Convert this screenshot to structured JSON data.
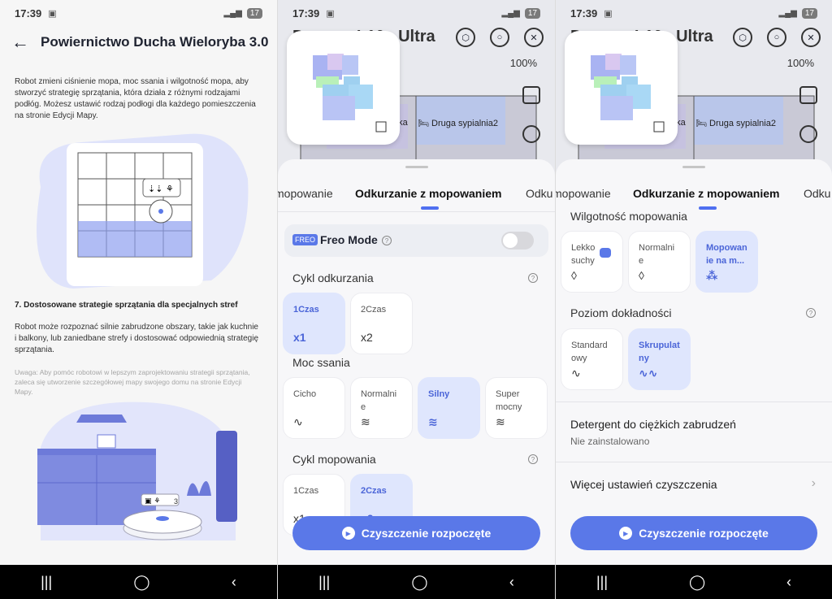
{
  "status": {
    "time": "17:39",
    "battery": "17"
  },
  "p1": {
    "title": "Powiernictwo Ducha Wieloryba 3.0",
    "para1": "Robot zmieni ciśnienie mopa, moc ssania i wilgotność mopa, aby stworzyć strategię sprzątania, która działa z różnymi rodzajami podłóg. Możesz ustawić rodzaj podłogi dla każdego pomieszczenia na stronie Edycji Mapy.",
    "heading7": "7. Dostosowane strategie sprzątania dla specjalnych stref",
    "para2": "Robot może rozpoznać silnie zabrudzone obszary, takie jak kuchnie i balkony, lub zaniedbane strefy i dostosować odpowiednią strategię sprzątania.",
    "note": "Uwaga: Aby pomóc robotowi w lepszym zaprojektowaniu strategii sprzątania, zaleca się utworzenie szczegółowej mapy swojego domu na stronie Edycji Mapy.",
    "illus_badge": "3"
  },
  "map": {
    "title": "Dreame L10s Ultra",
    "percent": "100%",
    "room1": "Druga sypialnia2",
    "room_partial": "nka"
  },
  "tabs": {
    "left": "mopowanie",
    "active": "Odkurzanie z mopowaniem",
    "right": "Odku"
  },
  "p2": {
    "freo_badge": "FREO",
    "freo_label": "Freo Mode",
    "cycle_label": "Cykl odkurzania",
    "cycle_opts": [
      {
        "t": "1Czas",
        "i": "x1"
      },
      {
        "t": "2Czas",
        "i": "x2"
      }
    ],
    "suction_label": "Moc ssania",
    "suction_opts": [
      {
        "t": "Cicho"
      },
      {
        "t": "Normalni e"
      },
      {
        "t": "Silny"
      },
      {
        "t": "Super mocny"
      }
    ],
    "mop_label": "Cykl mopowania",
    "mop_opts": [
      {
        "t": "1Czas",
        "i": "x1"
      },
      {
        "t": "2Czas",
        "i": "x2"
      }
    ],
    "cta": "Czyszczenie rozpoczęte"
  },
  "p3": {
    "wet_label": "Wilgotność mopowania",
    "wet_opts": [
      {
        "t": "Lekko suchy"
      },
      {
        "t": "Normalni e"
      },
      {
        "t": "Mopowan ie na m..."
      }
    ],
    "prec_label": "Poziom dokładności",
    "prec_opts": [
      {
        "t": "Standard owy"
      },
      {
        "t": "Skrupulat ny"
      }
    ],
    "det_title": "Detergent do ciężkich zabrudzeń",
    "det_value": "Nie zainstalowano",
    "more": "Więcej ustawień czyszczenia",
    "cta": "Czyszczenie rozpoczęte"
  }
}
